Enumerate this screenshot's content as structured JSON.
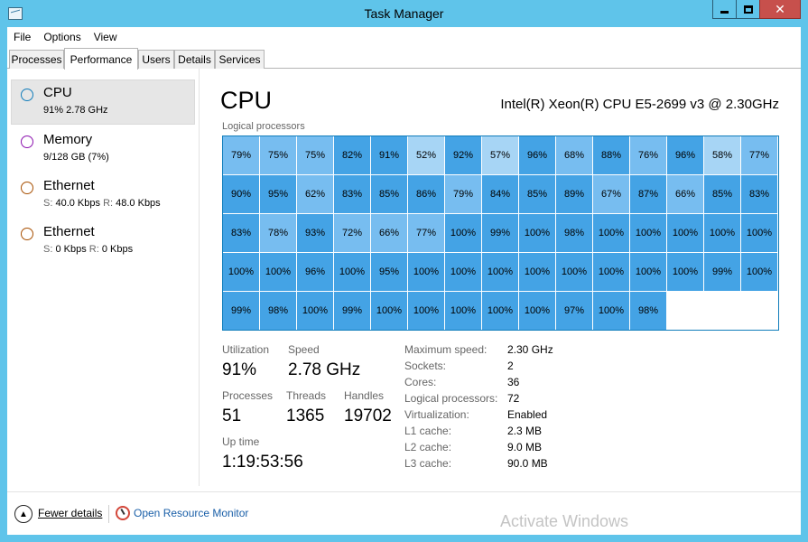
{
  "window": {
    "title": "Task Manager"
  },
  "menu": [
    "File",
    "Options",
    "View"
  ],
  "tabs": [
    "Processes",
    "Performance",
    "Users",
    "Details",
    "Services"
  ],
  "active_tab": "Performance",
  "sidebar": [
    {
      "title": "CPU",
      "line1": "91% 2.78 GHz",
      "color": "#117dbb"
    },
    {
      "title": "Memory",
      "line1": "9/128 GB (7%)",
      "color": "#8b12ae"
    },
    {
      "title": "Ethernet",
      "s_label": "S:",
      "s_val": "40.0 Kbps",
      "r_label": "R:",
      "r_val": "48.0 Kbps",
      "color": "#a74f01"
    },
    {
      "title": "Ethernet",
      "s_label": "S:",
      "s_val": "0 Kbps",
      "r_label": "R:",
      "r_val": "0 Kbps",
      "color": "#a74f01"
    }
  ],
  "main": {
    "title": "CPU",
    "model": "Intel(R) Xeon(R) CPU E5-2699 v3 @ 2.30GHz",
    "grid_label": "Logical processors",
    "logical_processors": [
      79,
      75,
      75,
      82,
      91,
      52,
      92,
      57,
      96,
      68,
      88,
      76,
      96,
      58,
      77,
      90,
      95,
      62,
      83,
      85,
      86,
      79,
      84,
      85,
      89,
      67,
      87,
      66,
      85,
      83,
      83,
      78,
      93,
      72,
      66,
      77,
      100,
      99,
      100,
      98,
      100,
      100,
      100,
      100,
      100,
      100,
      100,
      96,
      100,
      95,
      100,
      100,
      100,
      100,
      100,
      100,
      100,
      100,
      99,
      100,
      99,
      98,
      100,
      99,
      100,
      100,
      100,
      100,
      100,
      97,
      100,
      98
    ],
    "stats": {
      "utilization_label": "Utilization",
      "utilization": "91%",
      "speed_label": "Speed",
      "speed": "2.78 GHz",
      "processes_label": "Processes",
      "processes": "51",
      "threads_label": "Threads",
      "threads": "1365",
      "handles_label": "Handles",
      "handles": "19702",
      "uptime_label": "Up time",
      "uptime": "1:19:53:56"
    },
    "details": [
      {
        "label": "Maximum speed:",
        "value": "2.30 GHz"
      },
      {
        "label": "Sockets:",
        "value": "2"
      },
      {
        "label": "Cores:",
        "value": "36"
      },
      {
        "label": "Logical processors:",
        "value": "72"
      },
      {
        "label": "Virtualization:",
        "value": "Enabled"
      },
      {
        "label": "L1 cache:",
        "value": "2.3 MB"
      },
      {
        "label": "L2 cache:",
        "value": "9.0 MB"
      },
      {
        "label": "L3 cache:",
        "value": "90.0 MB"
      }
    ]
  },
  "footer": {
    "fewer_details": "Fewer details",
    "open_resource_monitor": "Open Resource Monitor",
    "watermark": "Activate Windows"
  },
  "colors": {
    "titlebar": "#5fc4ea",
    "close": "#c7504c",
    "grid_border": "#117dbb",
    "cell_light": "#a7d5f5",
    "cell_mid": "#77bdf0",
    "cell_dark": "#44a3e5",
    "link": "#1a5fa8"
  }
}
